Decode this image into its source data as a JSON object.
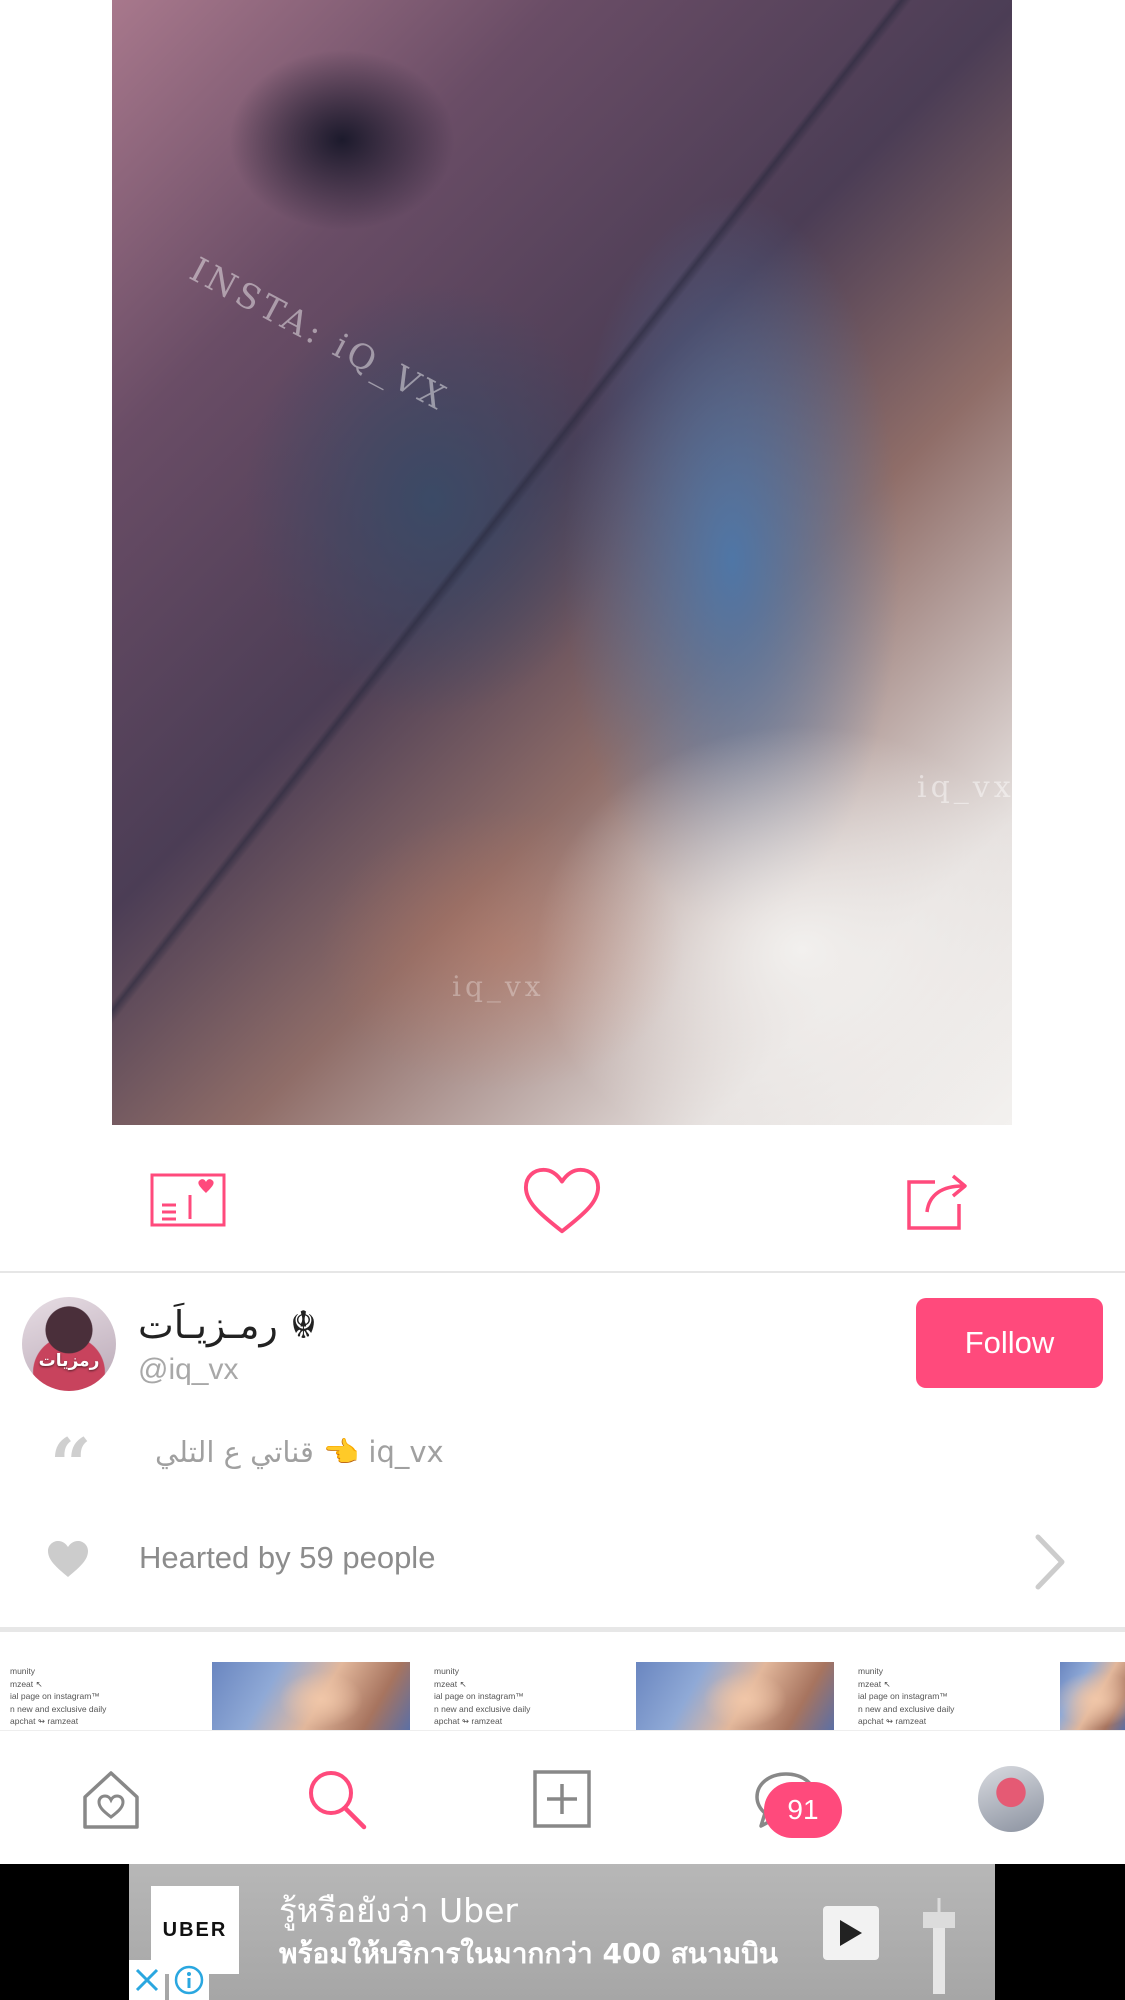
{
  "colors": {
    "accent": "#ff4a7c",
    "icon_gray": "#888888",
    "text_gray": "#a8a8a8"
  },
  "post": {
    "image_watermarks": [
      "INSTA: iQ_VX",
      "iq_vx",
      "iq_vx"
    ],
    "actions": [
      {
        "name": "postcard-icon"
      },
      {
        "name": "heart-outline-icon"
      },
      {
        "name": "share-icon"
      }
    ]
  },
  "user": {
    "display_name": "رمـزيـاَت ☬",
    "username": "@iq_vx",
    "avatar_text": "رمزيات",
    "follow_label": "Follow"
  },
  "caption": {
    "quote_icon": "quote-icon",
    "text": "قناتي ع التلي 👈 iq_vx"
  },
  "hearts": {
    "text": "Hearted by 59 people"
  },
  "thumbnails": [
    {
      "type": "text",
      "lines": [
        "munity",
        "mzeat ↖",
        "ial page on instagram™",
        "n new and exclusive daily",
        "apchat ↬ ramzeat"
      ]
    },
    {
      "type": "photo"
    },
    {
      "type": "text",
      "lines": [
        "munity",
        "mzeat ↖",
        "ial page on instagram™",
        "n new and exclusive daily",
        "apchat ↬ ramzeat"
      ]
    },
    {
      "type": "photo"
    },
    {
      "type": "text",
      "lines": [
        "munity",
        "mzeat ↖",
        "ial page on instagram™",
        "n new and exclusive daily",
        "apchat ↬ ramzeat"
      ]
    },
    {
      "type": "photo"
    }
  ],
  "tabbar": {
    "tabs": [
      "home-icon",
      "search-icon",
      "add-icon",
      "messages-icon",
      "profile-avatar"
    ],
    "messages_badge": "91"
  },
  "ad": {
    "brand": "UBER",
    "line1": "รู้หรือยังว่า Uber",
    "line2": "พร้อมให้บริการในมากกว่า 400 สนามบิน"
  }
}
